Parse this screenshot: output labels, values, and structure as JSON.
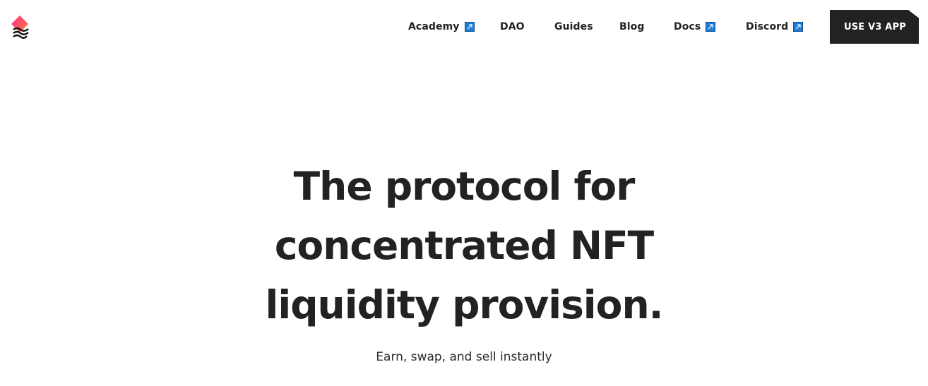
{
  "header": {
    "logo_icon": "brand-logo-icon",
    "nav": [
      {
        "label": "Academy",
        "external": true
      },
      {
        "label": "DAO",
        "external": false
      },
      {
        "label": "Guides",
        "external": false
      },
      {
        "label": "Blog",
        "external": false
      },
      {
        "label": "Docs",
        "external": true
      },
      {
        "label": "Discord",
        "external": true
      }
    ],
    "cta_label": "USE V3 APP"
  },
  "hero": {
    "title_lines": [
      "The protocol for",
      "concentrated NFT",
      "liquidity provision."
    ],
    "subtitle": "Earn, swap, and sell instantly"
  },
  "colors": {
    "text": "#222222",
    "cta_bg": "#222222",
    "cta_text": "#ffffff",
    "external_icon": "#1f7ed8",
    "logo_gradient_top": "#ff3d7f",
    "logo_gradient_bottom": "#ff6a3d"
  }
}
